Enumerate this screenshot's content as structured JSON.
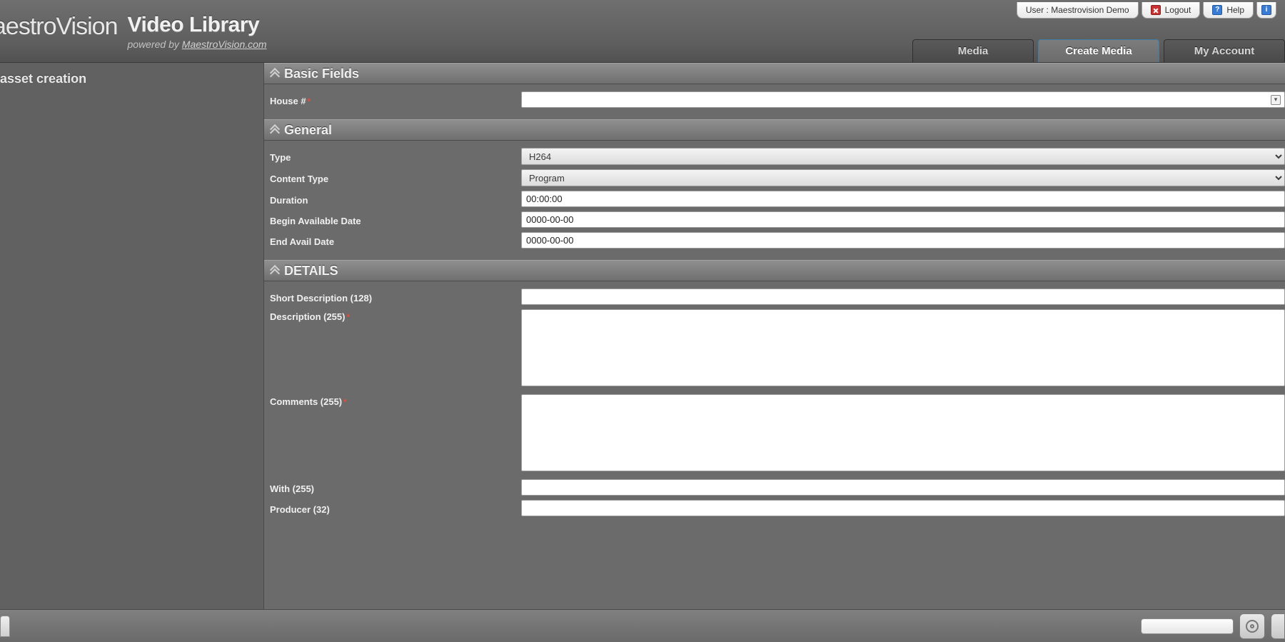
{
  "userbar": {
    "user_label": "User : Maestrovision Demo",
    "logout": "Logout",
    "help": "Help"
  },
  "header": {
    "logo": "aestroVision",
    "title": "Video Library",
    "subtitle_prefix": "powered by ",
    "subtitle_link": "MaestroVision.com"
  },
  "tabs": {
    "media": "Media",
    "create_media": "Create Media",
    "my_account": "My Account"
  },
  "sidebar": {
    "title": "asset creation"
  },
  "sections": {
    "basic": {
      "title": "Basic Fields",
      "house_label": "House #",
      "house_value": ""
    },
    "general": {
      "title": "General",
      "type_label": "Type",
      "type_value": "H264",
      "content_type_label": "Content Type",
      "content_type_value": "Program",
      "duration_label": "Duration",
      "duration_value": "00:00:00",
      "begin_label": "Begin Available Date",
      "begin_value": "0000-00-00",
      "end_label": "End Avail Date",
      "end_value": "0000-00-00"
    },
    "details": {
      "title": "DETAILS",
      "short_desc_label": "Short Description (128)",
      "short_desc_value": "",
      "desc_label": "Description (255)",
      "desc_value": "",
      "comments_label": "Comments (255)",
      "comments_value": "",
      "with_label": "With (255)",
      "with_value": "",
      "producer_label": "Producer (32)",
      "producer_value": ""
    }
  }
}
